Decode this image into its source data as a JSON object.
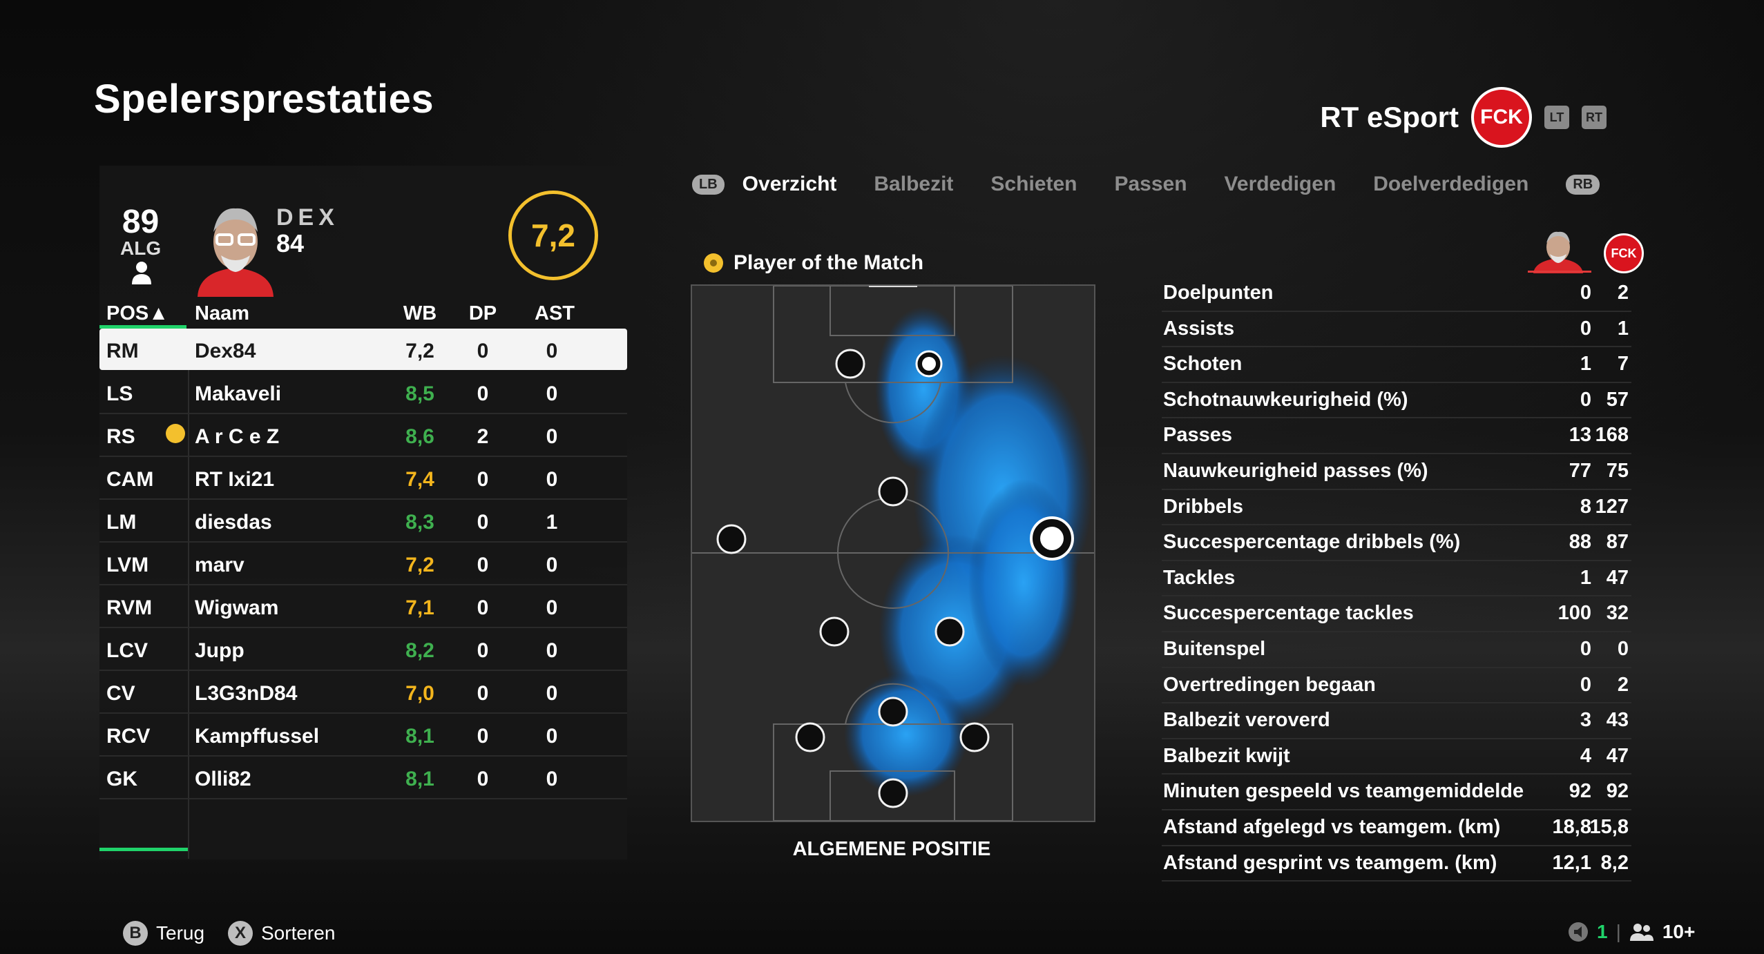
{
  "title": "Spelersprestaties",
  "team": {
    "name": "RT eSport",
    "club_badge": "1.FCK",
    "buttons": [
      "LT",
      "RT"
    ]
  },
  "player_card": {
    "overall": "89",
    "overall_label": "ALG",
    "name": "DEX",
    "number": "84",
    "rating": "7,2"
  },
  "table": {
    "headers": {
      "pos": "POS▲",
      "name": "Naam",
      "wb": "WB",
      "dp": "DP",
      "ast": "AST"
    },
    "rows": [
      {
        "pos": "RM",
        "name": "Dex84",
        "wb": "7,2",
        "dp": "0",
        "ast": "0",
        "color": "dark"
      },
      {
        "pos": "LS",
        "name": "Makaveli",
        "wb": "8,5",
        "dp": "0",
        "ast": "0",
        "color": "green"
      },
      {
        "pos": "RS",
        "name": "A r C e Z",
        "wb": "8,6",
        "dp": "2",
        "ast": "0",
        "color": "green"
      },
      {
        "pos": "CAM",
        "name": "RT Ixi21",
        "wb": "7,4",
        "dp": "0",
        "ast": "0",
        "color": "yellow"
      },
      {
        "pos": "LM",
        "name": "diesdas",
        "wb": "8,3",
        "dp": "0",
        "ast": "1",
        "color": "green"
      },
      {
        "pos": "LVM",
        "name": "marv",
        "wb": "7,2",
        "dp": "0",
        "ast": "0",
        "color": "yellow"
      },
      {
        "pos": "RVM",
        "name": "Wigwam",
        "wb": "7,1",
        "dp": "0",
        "ast": "0",
        "color": "yellow"
      },
      {
        "pos": "LCV",
        "name": "Jupp",
        "wb": "8,2",
        "dp": "0",
        "ast": "0",
        "color": "green"
      },
      {
        "pos": "CV",
        "name": "L3G3nD84",
        "wb": "7,0",
        "dp": "0",
        "ast": "0",
        "color": "yellow"
      },
      {
        "pos": "RCV",
        "name": "Kampffussel",
        "wb": "8,1",
        "dp": "0",
        "ast": "0",
        "color": "green"
      },
      {
        "pos": "GK",
        "name": "Olli82",
        "wb": "8,1",
        "dp": "0",
        "ast": "0",
        "color": "green"
      }
    ]
  },
  "tabs": {
    "left_button": "LB",
    "right_button": "RB",
    "items": [
      "Overzicht",
      "Balbezit",
      "Schieten",
      "Passen",
      "Verdedigen",
      "Doelverdedigen"
    ],
    "active": "Overzicht"
  },
  "motm_label": "Player of the Match",
  "pitch_label": "ALGEMENE POSITIE",
  "stats": [
    {
      "label": "Doelpunten",
      "player": "0",
      "team": "2"
    },
    {
      "label": "Assists",
      "player": "0",
      "team": "1"
    },
    {
      "label": "Schoten",
      "player": "1",
      "team": "7"
    },
    {
      "label": "Schotnauwkeurigheid (%)",
      "player": "0",
      "team": "57"
    },
    {
      "label": "Passes",
      "player": "13",
      "team": "168"
    },
    {
      "label": "Nauwkeurigheid passes (%)",
      "player": "77",
      "team": "75"
    },
    {
      "label": "Dribbels",
      "player": "8",
      "team": "127"
    },
    {
      "label": "Succespercentage dribbels (%)",
      "player": "88",
      "team": "87"
    },
    {
      "label": "Tackles",
      "player": "1",
      "team": "47"
    },
    {
      "label": "Succespercentage tackles",
      "player": "100",
      "team": "32"
    },
    {
      "label": "Buitenspel",
      "player": "0",
      "team": "0"
    },
    {
      "label": "Overtredingen begaan",
      "player": "0",
      "team": "2"
    },
    {
      "label": "Balbezit veroverd",
      "player": "3",
      "team": "43"
    },
    {
      "label": "Balbezit kwijt",
      "player": "4",
      "team": "47"
    },
    {
      "label": "Minuten gespeeld vs teamgemiddelde",
      "player": "92",
      "team": "92"
    },
    {
      "label": "Afstand afgelegd vs teamgem. (km)",
      "player": "18,8",
      "team": "15,8"
    },
    {
      "label": "Afstand gesprint vs teamgem. (km)",
      "player": "12,1",
      "team": "8,2"
    }
  ],
  "footer": {
    "back_button": "B",
    "back_label": "Terug",
    "sort_button": "X",
    "sort_label": "Sorteren",
    "mic_count": "1",
    "players_count": "10+"
  },
  "colors": {
    "accent_green": "#20d36a",
    "rating_yellow": "#f3b51d",
    "rating_green": "#3fb04f",
    "heat_blue": "#1e9bff"
  }
}
